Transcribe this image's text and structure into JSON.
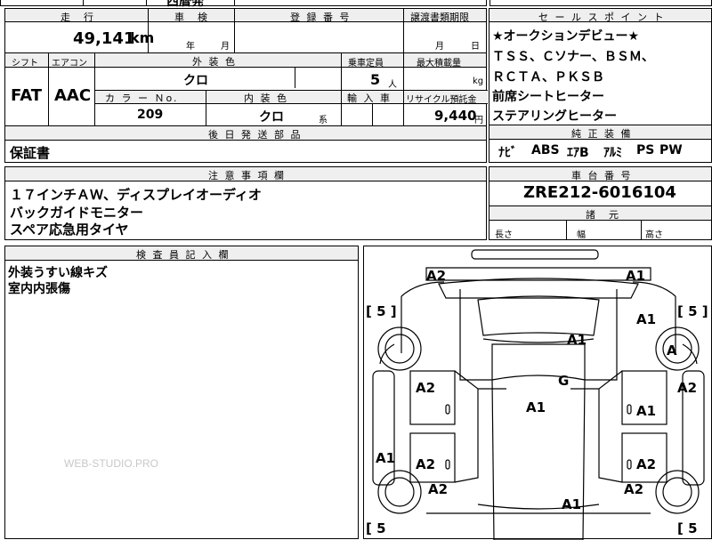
{
  "top_strip": {
    "partial_text": "西暦発"
  },
  "header_row": {
    "mileage_label": "走　行",
    "inspection_label": "車　検",
    "registration_label": "登 録 番 号",
    "transfer_deadline_label": "譲渡書類期限",
    "mileage_value": "49,141",
    "mileage_unit": "km",
    "inspection_year": "年",
    "inspection_month": "月",
    "transfer_month": "月",
    "transfer_day": "日"
  },
  "vehicle_info": {
    "shift_label": "シフト",
    "aircon_label": "エアコン",
    "exterior_color_label": "外 装 色",
    "capacity_label": "乗車定員",
    "max_load_label": "最大積載量",
    "shift_value": "FAT",
    "aircon_value": "AAC",
    "exterior_color_value": "クロ",
    "capacity_value": "5",
    "capacity_unit": "人",
    "max_load_unit": "kg",
    "color_no_label": "カ ラ ー Ｎo.",
    "interior_color_label": "内 装 色",
    "import_label": "輸 入 車",
    "recycle_label": "リサイクル預託金",
    "color_no_value": "209",
    "interior_color_value": "クロ",
    "interior_color_suffix": "系",
    "recycle_value": "9,440",
    "recycle_unit": "円"
  },
  "delivery_parts": {
    "label": "後 日 発 送 部 品",
    "value": "保証書"
  },
  "sales_points": {
    "label": "セ ー ル ス ポ イ ン ト",
    "lines": [
      "★オークションデビュー★",
      "ＴＳＳ、Ｃソナー、ＢＳＭ、",
      "ＲＣＴＡ、ＰＫＳＢ",
      "前席シートヒーター",
      "ステアリングヒーター"
    ]
  },
  "equipment": {
    "label": "純 正 装 備",
    "items": [
      "ﾅﾋﾞ",
      "ABS",
      "ｴｱB",
      "ｱﾙﾐ",
      "PS",
      "PW"
    ]
  },
  "notes": {
    "label": "注 意 事 項 欄",
    "lines": [
      "１７インチＡＷ、ディスプレイオーディオ",
      "バックガイドモニター",
      "スペア応急用タイヤ"
    ]
  },
  "chassis": {
    "label": "車 台 番 号",
    "value": "ZRE212-6016104"
  },
  "dimensions": {
    "label": "諸　元",
    "length_label": "長さ",
    "width_label": "幅",
    "height_label": "高さ"
  },
  "inspector": {
    "label": "検 査 員 記 入 欄",
    "lines": [
      "外装うすい線キズ",
      "室内内張傷"
    ]
  },
  "diagram": {
    "marks": [
      "A2",
      "A1",
      "A1",
      "A1",
      "A",
      "A2",
      "G",
      "A2",
      "A1",
      "A1",
      "A1",
      "A2",
      "A2",
      "A2",
      "A2",
      "A1"
    ],
    "tire_marks": [
      "[ 5 ]",
      "[ 5 ]",
      "[ 5",
      "[ 5"
    ]
  },
  "watermark": "WEB-STUDIO.PRO"
}
